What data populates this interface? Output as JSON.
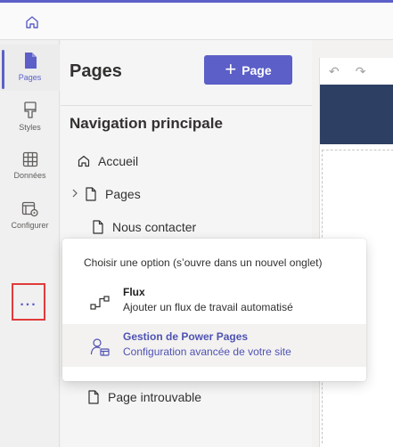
{
  "rail": {
    "items": [
      {
        "label": "Pages"
      },
      {
        "label": "Styles"
      },
      {
        "label": "Données"
      },
      {
        "label": "Configurer"
      }
    ],
    "more_label": "..."
  },
  "panel": {
    "title": "Pages",
    "add_button_label": "Page",
    "add_button_icon": "+",
    "section_title": "Navigation principale",
    "items": [
      {
        "label": "Accueil",
        "icon": "home-icon"
      },
      {
        "label": "Pages",
        "icon": "page-icon",
        "expandable": true
      },
      {
        "label": "Nous contacter",
        "icon": "page-icon"
      },
      {
        "label": "Page introuvable",
        "icon": "page-icon"
      }
    ]
  },
  "flyout": {
    "header": "Choisir une option (s’ouvre dans un nouvel onglet)",
    "options": [
      {
        "title": "Flux",
        "description": "Ajouter un flux de travail automatisé",
        "icon": "flow-icon"
      },
      {
        "title": "Gestion de Power Pages",
        "description": "Configuration avancée de votre site",
        "icon": "portal-management-icon"
      }
    ]
  },
  "canvas": {
    "undo_icon": "↶",
    "redo_icon": "↷"
  },
  "colors": {
    "accent": "#5b5fc7",
    "header_dark": "#2d3f63",
    "highlight_red": "#e03b3b"
  }
}
